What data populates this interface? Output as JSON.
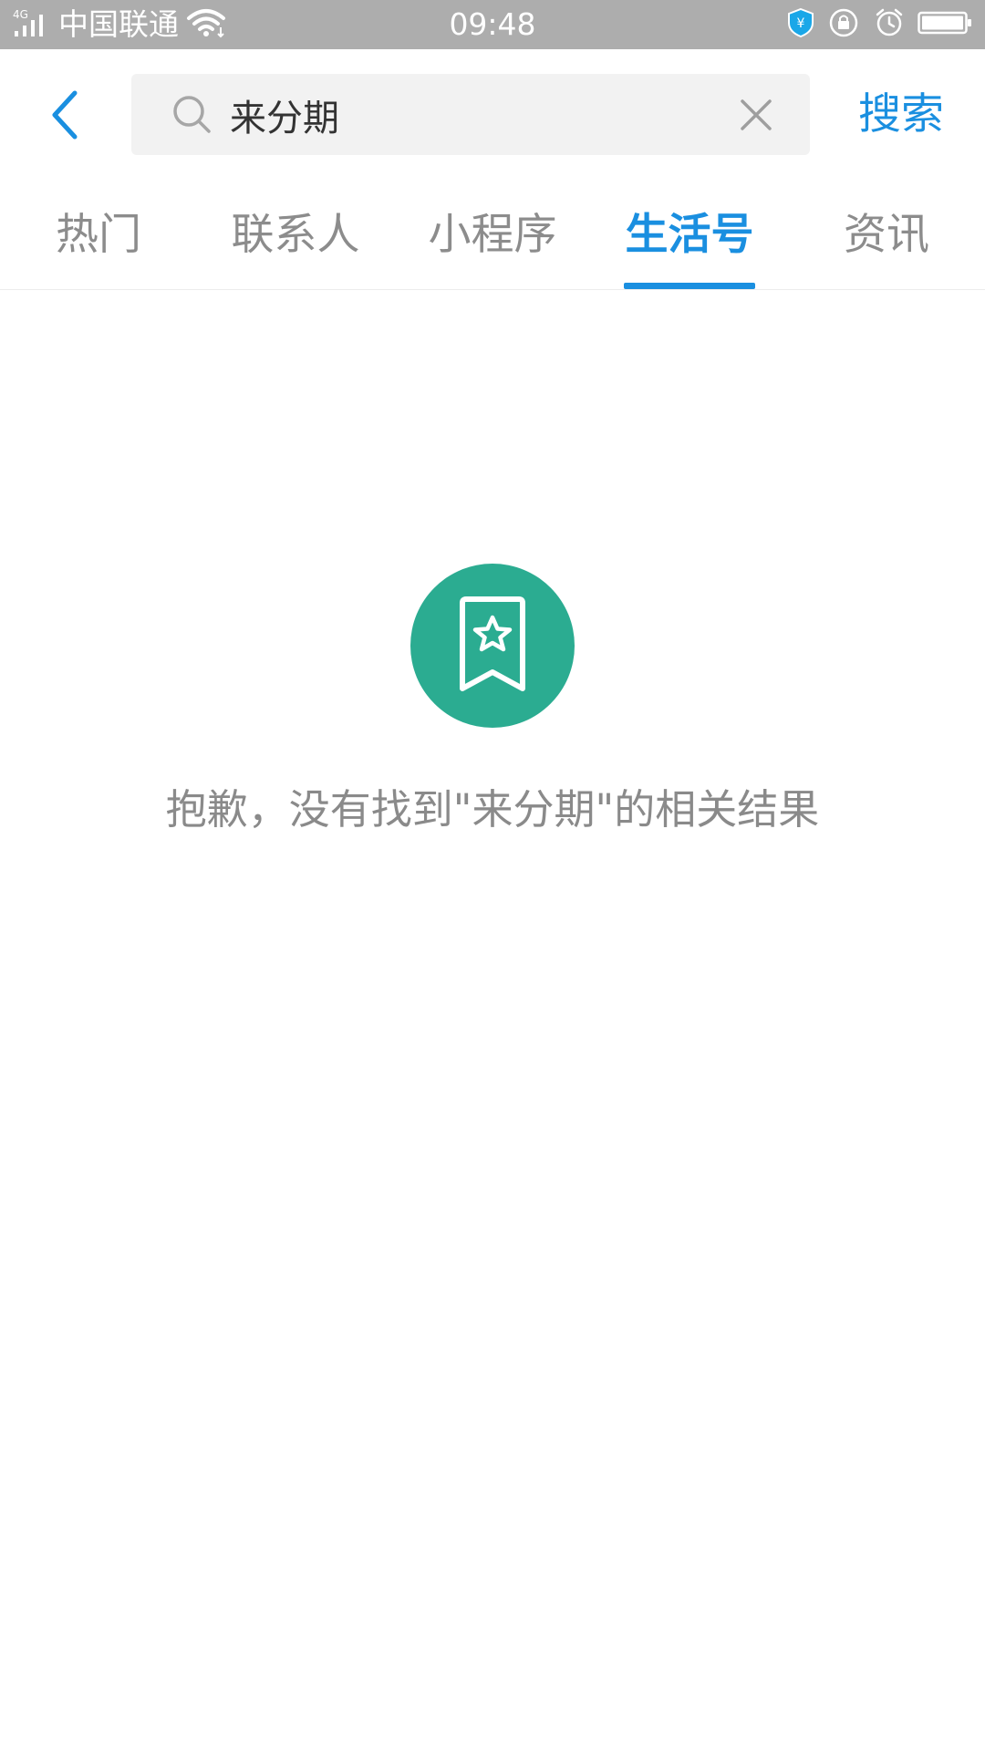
{
  "status_bar": {
    "network": "4G",
    "carrier": "中国联通",
    "time": "09:48",
    "icons": [
      "signal-icon",
      "wifi-icon",
      "payment-shield-icon",
      "screen-rotation-lock-icon",
      "alarm-icon",
      "battery-icon"
    ]
  },
  "header": {
    "back_icon": "chevron-left-icon",
    "search": {
      "value": "来分期",
      "placeholder": ""
    },
    "search_button_label": "搜索"
  },
  "tabs": [
    {
      "label": "热门",
      "active": false
    },
    {
      "label": "联系人",
      "active": false
    },
    {
      "label": "小程序",
      "active": false
    },
    {
      "label": "生活号",
      "active": true
    },
    {
      "label": "资讯",
      "active": false
    }
  ],
  "empty_state": {
    "icon": "bookmark-star-icon",
    "message": "抱歉，没有找到\"来分期\"的相关结果"
  },
  "colors": {
    "accent": "#1a8fe0",
    "status_bar": "#adadad",
    "empty_icon_bg": "#2bac91",
    "inactive_tab": "#8c8c8c"
  }
}
